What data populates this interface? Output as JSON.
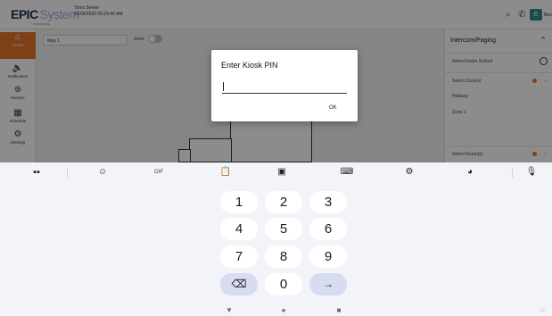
{
  "app": {
    "logo_main": "EPIC",
    "logo_system": "System",
    "logo_sub": "ENTERPRISE",
    "server_name": "Toms Server",
    "server_time": "12/04/2020 09:29:40 AM",
    "user_initial": "E",
    "user_name": "Ben"
  },
  "sidenav": {
    "items": [
      {
        "label": "Home",
        "icon": "home-icon",
        "glyph": "⌂"
      },
      {
        "label": "Notification",
        "icon": "speaker-icon",
        "glyph": "🔈"
      },
      {
        "label": "Musync",
        "icon": "sync-icon",
        "glyph": "⊛"
      },
      {
        "label": "Schedule",
        "icon": "calendar-icon",
        "glyph": "▦"
      },
      {
        "label": "Settings",
        "icon": "gear-icon",
        "glyph": "⚙"
      }
    ]
  },
  "map": {
    "map_select_value": "Map 1",
    "zone_label": "Zone"
  },
  "right_panel": {
    "title": "Intercom/Paging",
    "select_school": "Select Entire School",
    "select_zones": "Select Zone(s)",
    "zones": [
      "Hallway",
      "Zone 1"
    ],
    "select_rooms": "Select Room(s)"
  },
  "dialog": {
    "title": "Enter Kiosk PIN",
    "input_value": "",
    "ok_label": "OK"
  },
  "keyboard": {
    "toolbar": {
      "apps_icon": "grid-icon",
      "sticker_icon": "sticker-icon",
      "gif_label": "GIF",
      "clipboard_icon": "clipboard-icon",
      "translate_icon": "translate-icon",
      "onehand_icon": "one-hand-icon",
      "settings_icon": "gear-icon",
      "theme_icon": "palette-icon",
      "mic_icon": "microphone-icon"
    },
    "rows": [
      [
        "1",
        "2",
        "3"
      ],
      [
        "4",
        "5",
        "6"
      ],
      [
        "7",
        "8",
        "9"
      ],
      [
        "⌫",
        "0",
        "→"
      ]
    ]
  },
  "navbar": {
    "back": "▼",
    "home": "●",
    "recents": "■"
  },
  "colors": {
    "accent": "#e9752a",
    "keyboard_bg": "#f3f4f9",
    "fn_key": "#d7dcf1",
    "brand": "#1f2d5c"
  }
}
